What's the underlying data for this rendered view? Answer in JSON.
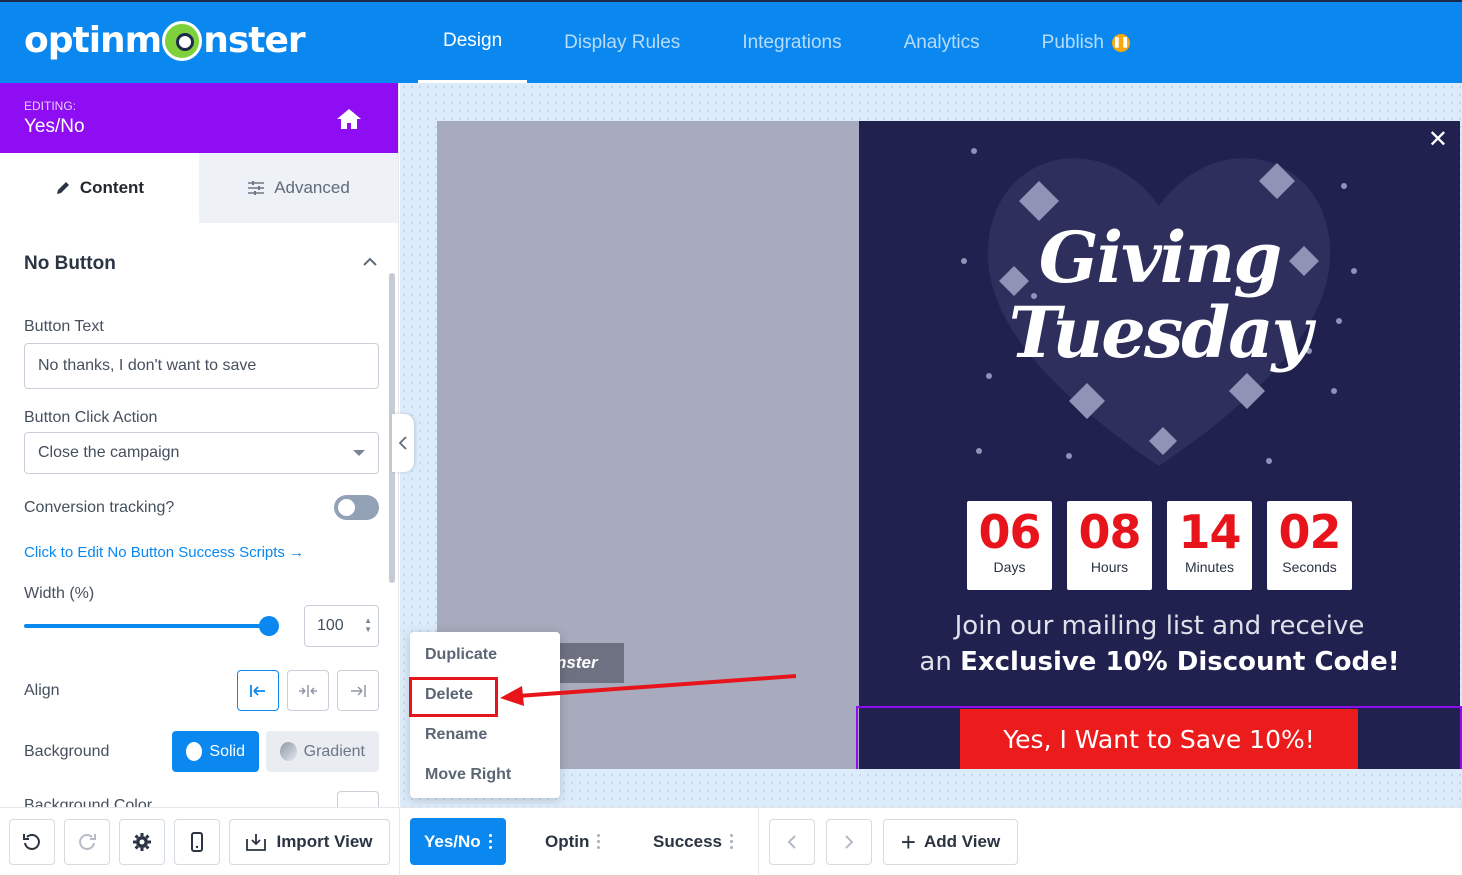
{
  "app": {
    "logo_text_left": "optinm",
    "logo_text_right": "nster"
  },
  "nav": {
    "tabs": [
      {
        "label": "Design",
        "active": true
      },
      {
        "label": "Display Rules",
        "active": false
      },
      {
        "label": "Integrations",
        "active": false
      },
      {
        "label": "Analytics",
        "active": false
      },
      {
        "label": "Publish",
        "active": false,
        "badge_icon": "pause-icon"
      }
    ]
  },
  "sidebar": {
    "editing_label": "EDITING:",
    "editing_title": "Yes/No",
    "tabs": {
      "content": "Content",
      "advanced": "Advanced"
    },
    "section_title": "No Button",
    "button_text_label": "Button Text",
    "button_text_value": "No thanks, I don't want to save",
    "click_action_label": "Button Click Action",
    "click_action_value": "Close the campaign",
    "conversion_label": "Conversion tracking?",
    "conversion_enabled": false,
    "success_link": "Click to Edit No Button Success Scripts →",
    "width_label": "Width (%)",
    "width_value": "100",
    "align_label": "Align",
    "background_label": "Background",
    "bg_solid": "Solid",
    "bg_gradient": "Gradient",
    "bg_color_label": "Background Color"
  },
  "popup": {
    "title_line1": "Giving",
    "title_line2": "Tuesday",
    "countdown": [
      {
        "value": "06",
        "label": "Days"
      },
      {
        "value": "08",
        "label": "Hours"
      },
      {
        "value": "14",
        "label": "Minutes"
      },
      {
        "value": "02",
        "label": "Seconds"
      }
    ],
    "join_line1": "Join our mailing list and receive",
    "join_line2_prefix": "an ",
    "join_line2_bold": "Exclusive 10% Discount Code!",
    "cta": "Yes, I Want to Save 10%!",
    "ghost_button_text": "nster"
  },
  "context_menu": {
    "items": [
      "Duplicate",
      "Delete",
      "Rename",
      "Move Right"
    ],
    "highlighted": "Delete"
  },
  "bottombar": {
    "import_view": "Import View",
    "views": [
      {
        "label": "Yes/No",
        "active": true
      },
      {
        "label": "Optin",
        "active": false
      },
      {
        "label": "Success",
        "active": false
      }
    ],
    "add_view": "Add View"
  },
  "colors": {
    "brand_blue": "#0a88f0",
    "editing_purple": "#8e0df2",
    "popup_bg": "#20214f",
    "cta_red": "#ed1c1c",
    "highlight_red": "#e8141c"
  }
}
